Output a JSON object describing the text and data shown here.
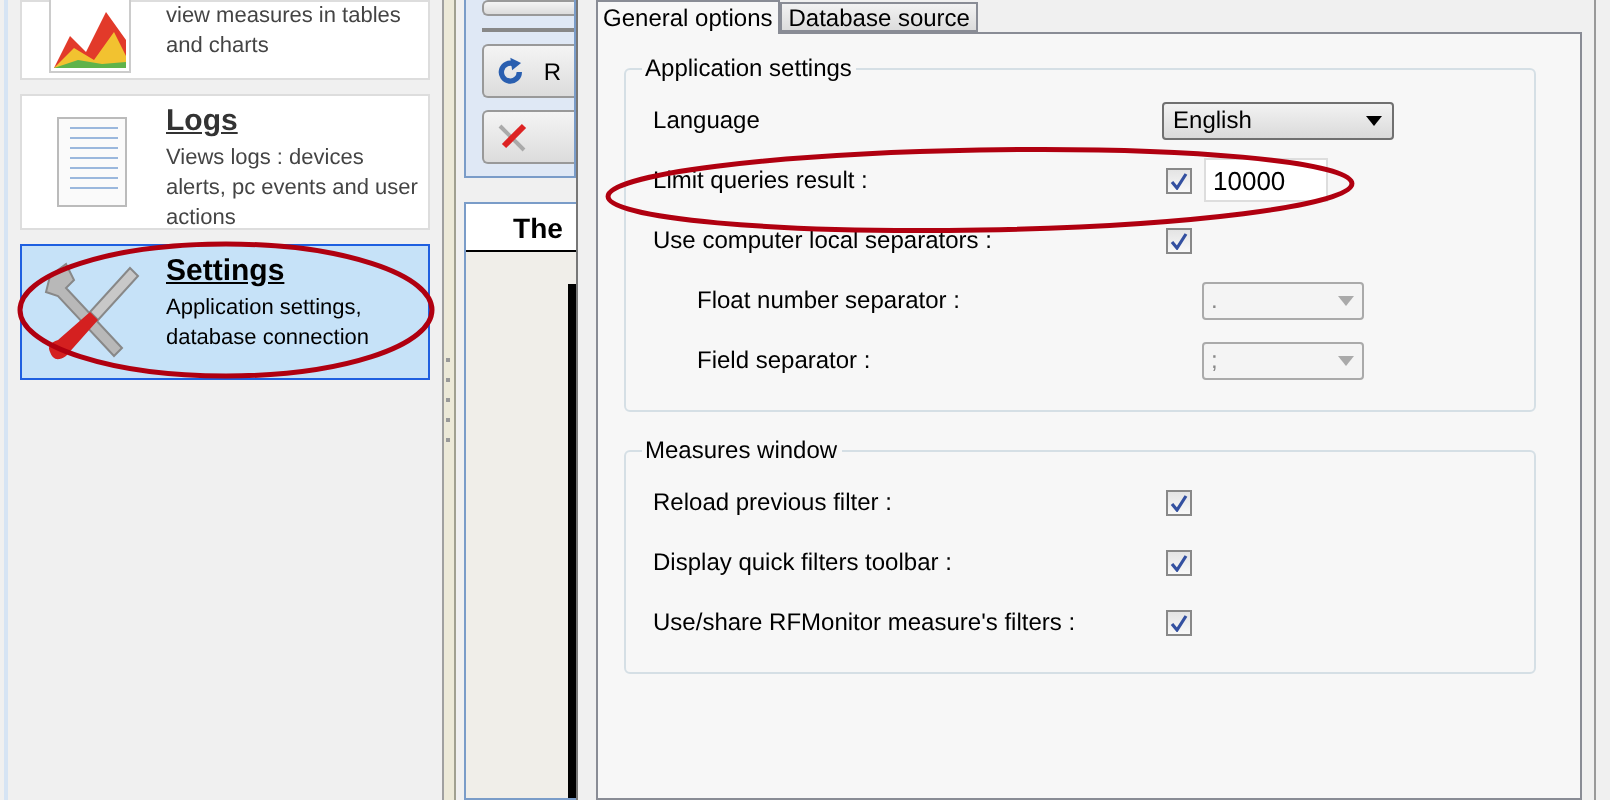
{
  "sidebar": {
    "items": [
      {
        "description": "view measures in tables and charts",
        "selected": false
      },
      {
        "title": "Logs",
        "description": "Views logs : devices alerts, pc events and user actions",
        "selected": false
      },
      {
        "title": "Settings",
        "description": "Application settings, database connection",
        "selected": true
      }
    ]
  },
  "middle_panel": {
    "buttons": [
      {
        "label": "R"
      }
    ],
    "header": "The"
  },
  "dialog": {
    "tabs": [
      {
        "label": "General options",
        "selected": true
      },
      {
        "label": "Database source",
        "selected": false
      }
    ],
    "groups": [
      {
        "title": "Application settings",
        "rows": [
          {
            "label": "Language",
            "kind": "dropdown",
            "value": "English",
            "indented": false
          },
          {
            "label": "Limit queries result :",
            "kind": "check-input",
            "checked": true,
            "value": "10000",
            "indented": false
          },
          {
            "label": "Use computer local separators :",
            "kind": "checkbox",
            "checked": true,
            "indented": false
          },
          {
            "label": "Float number separator :",
            "kind": "combo",
            "value": ".",
            "disabled": true,
            "indented": true
          },
          {
            "label": "Field separator :",
            "kind": "combo",
            "value": ";",
            "disabled": true,
            "indented": true
          }
        ]
      },
      {
        "title": "Measures window",
        "rows": [
          {
            "label": "Reload previous filter :",
            "kind": "checkbox",
            "checked": true,
            "indented": false
          },
          {
            "label": "Display quick filters toolbar :",
            "kind": "checkbox",
            "checked": true,
            "indented": false
          },
          {
            "label": "Use/share RFMonitor measure's filters :",
            "kind": "checkbox",
            "checked": true,
            "indented": false
          }
        ]
      }
    ]
  }
}
